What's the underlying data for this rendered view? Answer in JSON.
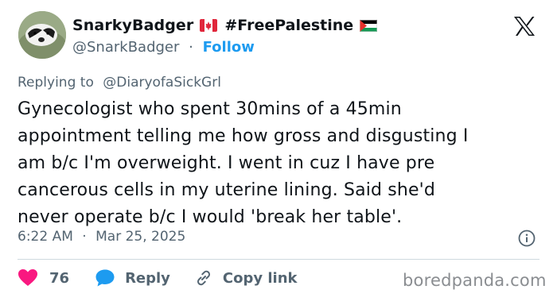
{
  "author": {
    "display_name": "SnarkyBadger",
    "hashtag": "#FreePalestine",
    "handle": "@SnarkBadger",
    "separator": "·",
    "follow_label": "Follow"
  },
  "reply": {
    "prefix": "Replying to",
    "to_handle": "@DiaryofaSickGrl"
  },
  "tweet": {
    "lines": [
      "Gynecologist who spent 30mins of a 45min",
      "appointment telling me how gross and disgusting I",
      "am b/c I'm overweight. I went in cuz I have pre",
      "cancerous cells in my uterine lining. Said she'd",
      "never operate b/c I would 'break her table'."
    ]
  },
  "meta": {
    "time": "6:22 AM",
    "separator": "·",
    "date": "Mar 25, 2025"
  },
  "actions": {
    "likes_count": "76",
    "reply_label": "Reply",
    "copy_label": "Copy link"
  },
  "watermark": "boredpanda.com",
  "colors": {
    "accent_blue": "#1d9bf0",
    "like_red": "#f91880",
    "secondary_text": "#536471"
  },
  "icons": [
    "badger-avatar",
    "canada-flag-icon",
    "palestine-flag-icon",
    "x-logo-icon",
    "info-icon",
    "heart-icon",
    "reply-bubble-icon",
    "link-icon"
  ]
}
